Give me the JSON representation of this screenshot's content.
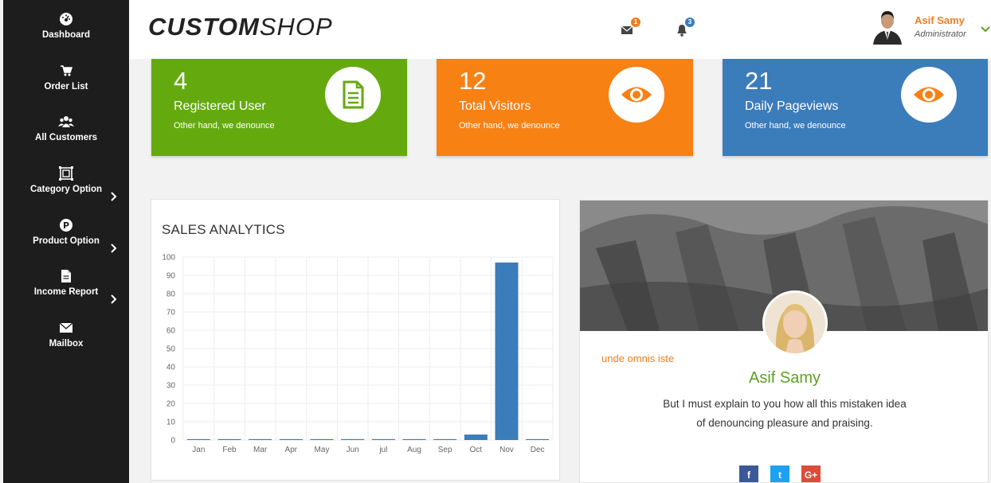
{
  "brand": {
    "part1": "CUSTOM",
    "part2": "SHOP"
  },
  "sidebar": {
    "items": [
      {
        "label": "Dashboard",
        "icon": "dashboard-icon",
        "has_submenu": false
      },
      {
        "label": "Order List",
        "icon": "cart-icon",
        "has_submenu": false
      },
      {
        "label": "All Customers",
        "icon": "users-icon",
        "has_submenu": false
      },
      {
        "label": "Category Option",
        "icon": "category-icon",
        "has_submenu": true
      },
      {
        "label": "Product Option",
        "icon": "product-icon",
        "has_submenu": true
      },
      {
        "label": "Income Report",
        "icon": "report-icon",
        "has_submenu": true
      },
      {
        "label": "Mailbox",
        "icon": "mail-icon",
        "has_submenu": false
      }
    ]
  },
  "header": {
    "messages_count": "1",
    "notifications_count": "3",
    "user": {
      "name": "Asif Samy",
      "role": "Administrator"
    }
  },
  "stats": [
    {
      "value": "4",
      "title": "Registered User",
      "subtitle": "Other hand, we denounce",
      "icon": "document-icon",
      "color": "#64aa0f"
    },
    {
      "value": "12",
      "title": "Total Visitors",
      "subtitle": "Other hand, we denounce",
      "icon": "eye-icon",
      "color": "#f88114"
    },
    {
      "value": "21",
      "title": "Daily Pageviews",
      "subtitle": "Other hand, we denounce",
      "icon": "eye-icon",
      "color": "#3b7cbb"
    }
  ],
  "sales": {
    "title": "SALES ANALYTICS"
  },
  "chart_data": {
    "type": "bar",
    "title": "SALES ANALYTICS",
    "categories": [
      "Jan",
      "Feb",
      "Mar",
      "Apr",
      "May",
      "Jun",
      "jul",
      "Aug",
      "Sep",
      "Oct",
      "Nov",
      "Dec"
    ],
    "values": [
      0.5,
      0.5,
      0.5,
      0.5,
      0.5,
      0.5,
      0.5,
      0.5,
      0.5,
      3,
      97,
      0.5
    ],
    "ylim": [
      0,
      100
    ],
    "yticks": [
      0,
      10,
      20,
      30,
      40,
      50,
      60,
      70,
      80,
      90,
      100
    ],
    "grid": true,
    "color": "#3b7cbb"
  },
  "profile": {
    "tagline": "unde omnis iste",
    "name": "Asif Samy",
    "bio": "But I must explain to you how all this mistaken idea of denouncing pleasure and praising.",
    "social": [
      {
        "label": "f",
        "icon": "facebook-icon",
        "color": "#3b5998"
      },
      {
        "label": "t",
        "icon": "twitter-icon",
        "color": "#1da1f2"
      },
      {
        "label": "G+",
        "icon": "google-plus-icon",
        "color": "#dd4b39"
      }
    ]
  }
}
